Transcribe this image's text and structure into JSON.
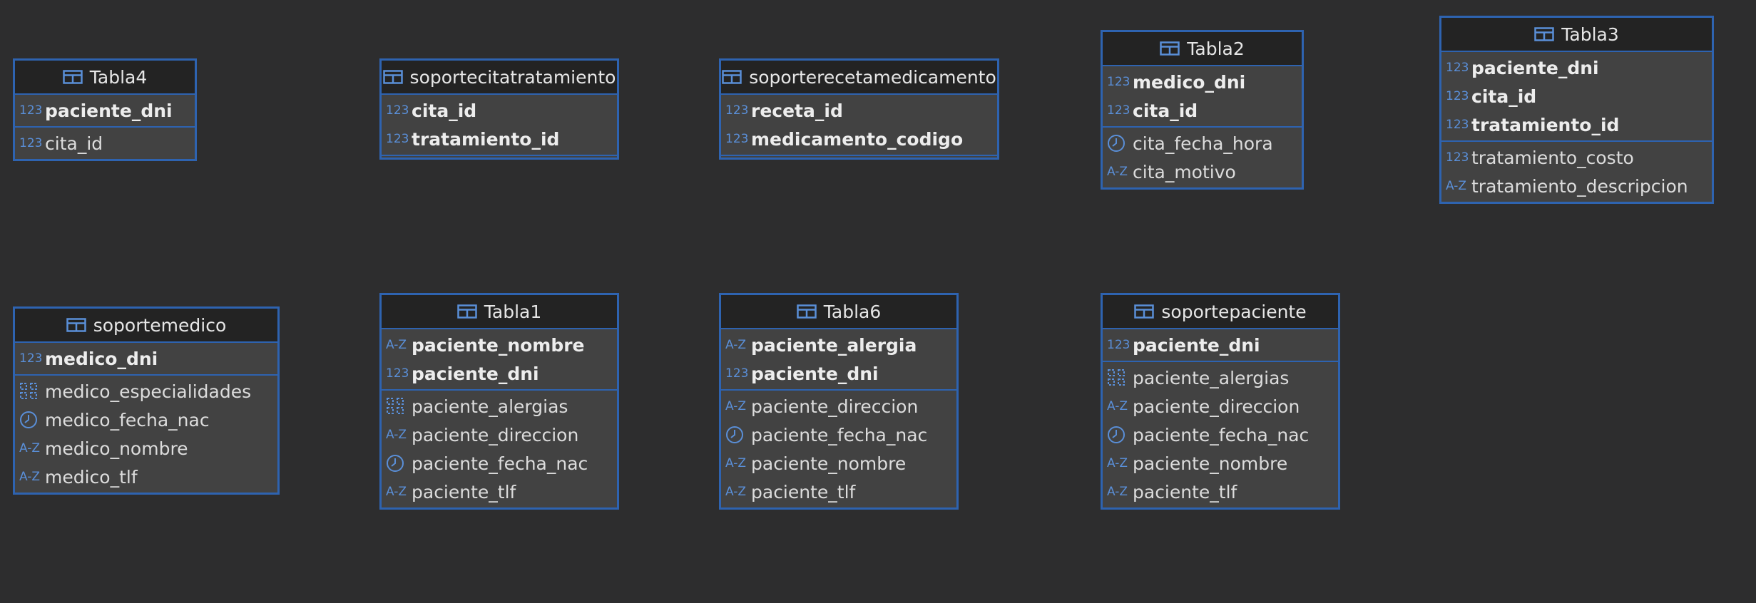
{
  "theme": {
    "background": "#2d2d2e",
    "border": "#2e63b0",
    "header_bg": "#232323",
    "body_bg": "#424242",
    "icon": "#5a8fd8"
  },
  "entities": [
    {
      "id": "tabla4",
      "title": "Tabla4",
      "pk": [
        {
          "name": "paciente_dni",
          "icon": "numeric-icon"
        }
      ],
      "fields": [
        {
          "name": "cita_id",
          "icon": "numeric-icon"
        }
      ]
    },
    {
      "id": "soportecitatratamiento",
      "title": "soportecitatratamiento",
      "pk": [
        {
          "name": "cita_id",
          "icon": "numeric-icon"
        },
        {
          "name": "tratamiento_id",
          "icon": "numeric-icon"
        }
      ],
      "fields": []
    },
    {
      "id": "soporterecetamedicamento",
      "title": "soporterecetamedicamento",
      "pk": [
        {
          "name": "receta_id",
          "icon": "numeric-icon"
        },
        {
          "name": "medicamento_codigo",
          "icon": "numeric-icon"
        }
      ],
      "fields": []
    },
    {
      "id": "tabla2",
      "title": "Tabla2",
      "pk": [
        {
          "name": "medico_dni",
          "icon": "numeric-icon"
        },
        {
          "name": "cita_id",
          "icon": "numeric-icon"
        }
      ],
      "fields": [
        {
          "name": "cita_fecha_hora",
          "icon": "clock-icon"
        },
        {
          "name": "cita_motivo",
          "icon": "text-icon"
        }
      ]
    },
    {
      "id": "tabla3",
      "title": "Tabla3",
      "pk": [
        {
          "name": "paciente_dni",
          "icon": "numeric-icon"
        },
        {
          "name": "cita_id",
          "icon": "numeric-icon"
        },
        {
          "name": "tratamiento_id",
          "icon": "numeric-icon"
        }
      ],
      "fields": [
        {
          "name": "tratamiento_costo",
          "icon": "numeric-icon"
        },
        {
          "name": "tratamiento_descripcion",
          "icon": "text-icon"
        }
      ]
    },
    {
      "id": "soportemedico",
      "title": "soportemedico",
      "pk": [
        {
          "name": "medico_dni",
          "icon": "numeric-icon"
        }
      ],
      "fields": [
        {
          "name": "medico_especialidades",
          "icon": "array-icon"
        },
        {
          "name": "medico_fecha_nac",
          "icon": "clock-icon"
        },
        {
          "name": "medico_nombre",
          "icon": "text-icon"
        },
        {
          "name": "medico_tlf",
          "icon": "text-icon"
        }
      ]
    },
    {
      "id": "tabla1",
      "title": "Tabla1",
      "pk": [
        {
          "name": "paciente_nombre",
          "icon": "text-icon"
        },
        {
          "name": "paciente_dni",
          "icon": "numeric-icon"
        }
      ],
      "fields": [
        {
          "name": "paciente_alergias",
          "icon": "array-icon"
        },
        {
          "name": "paciente_direccion",
          "icon": "text-icon"
        },
        {
          "name": "paciente_fecha_nac",
          "icon": "clock-icon"
        },
        {
          "name": "paciente_tlf",
          "icon": "text-icon"
        }
      ]
    },
    {
      "id": "tabla6",
      "title": "Tabla6",
      "pk": [
        {
          "name": "paciente_alergia",
          "icon": "text-icon"
        },
        {
          "name": "paciente_dni",
          "icon": "numeric-icon"
        }
      ],
      "fields": [
        {
          "name": "paciente_direccion",
          "icon": "text-icon"
        },
        {
          "name": "paciente_fecha_nac",
          "icon": "clock-icon"
        },
        {
          "name": "paciente_nombre",
          "icon": "text-icon"
        },
        {
          "name": "paciente_tlf",
          "icon": "text-icon"
        }
      ]
    },
    {
      "id": "soportepaciente",
      "title": "soportepaciente",
      "pk": [
        {
          "name": "paciente_dni",
          "icon": "numeric-icon"
        }
      ],
      "fields": [
        {
          "name": "paciente_alergias",
          "icon": "array-icon"
        },
        {
          "name": "paciente_direccion",
          "icon": "text-icon"
        },
        {
          "name": "paciente_fecha_nac",
          "icon": "clock-icon"
        },
        {
          "name": "paciente_nombre",
          "icon": "text-icon"
        },
        {
          "name": "paciente_tlf",
          "icon": "text-icon"
        }
      ]
    }
  ]
}
